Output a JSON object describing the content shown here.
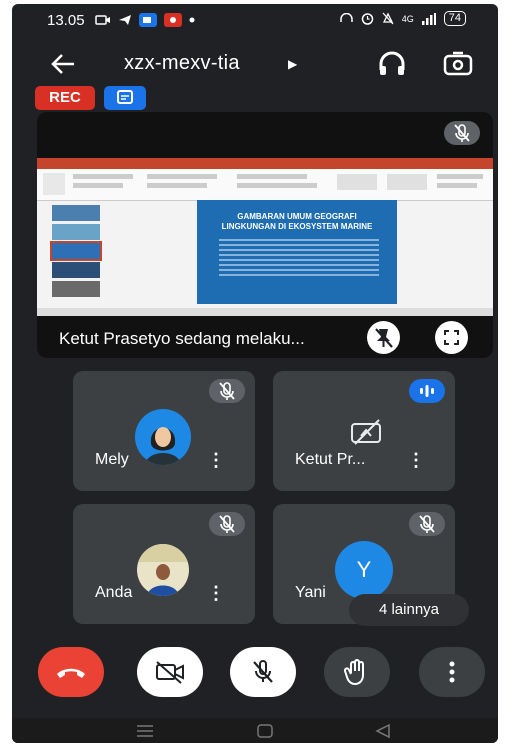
{
  "status_bar": {
    "time": "13.05",
    "signal_text": "4G",
    "battery": "74"
  },
  "meeting": {
    "code": "xzx-mexv-tia"
  },
  "badges": {
    "rec": "REC"
  },
  "presentation": {
    "caption": "Ketut Prasetyo sedang melaku...",
    "slide_title_line1": "GAMBARAN UMUM GEOGRAFI",
    "slide_title_line2": "LINGKUNGAN DI EKOSYSTEM MARINE"
  },
  "participants": [
    {
      "name": "Mely",
      "muted": true
    },
    {
      "name": "Ketut Pr...",
      "muted": false,
      "speaking": true
    },
    {
      "name": "Anda",
      "muted": true
    },
    {
      "name": "Yani",
      "initial": "Y",
      "muted": true
    }
  ],
  "others_label": "4 lainnya",
  "colors": {
    "rec": "#d93025",
    "accent": "#1a73e8",
    "end_call": "#ea4335"
  }
}
